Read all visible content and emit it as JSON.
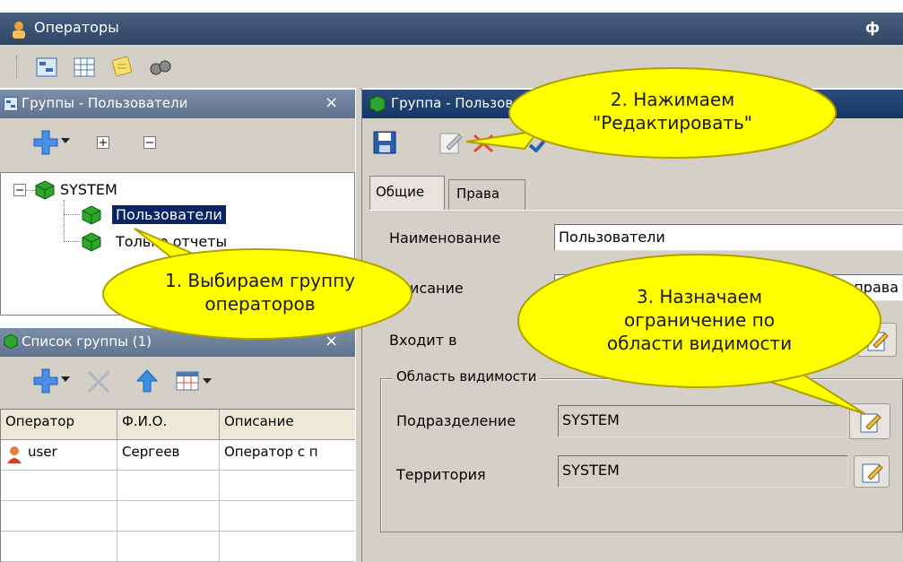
{
  "window": {
    "title": "Операторы",
    "pin_glyph": "ф"
  },
  "groups_panel": {
    "title": "Группы - Пользователи",
    "close_glyph": "×",
    "tree": [
      {
        "label": "SYSTEM",
        "expander": "−"
      },
      {
        "label": "Пользователи",
        "selected": true
      },
      {
        "label": "Только отчеты"
      }
    ]
  },
  "list_panel": {
    "title": "Список группы (1)",
    "close_glyph": "×",
    "columns": [
      "Оператор",
      "Ф.И.О.",
      "Описание"
    ],
    "rows": [
      [
        "user",
        "Сергеев",
        "Оператор с п"
      ]
    ]
  },
  "group_panel": {
    "title": "Группа - Пользователи",
    "tabs": [
      {
        "label": "Общие",
        "active": true
      },
      {
        "label": "Права",
        "active": false
      }
    ],
    "fields": {
      "name_label": "Наименование",
      "name_value": "Пользователи",
      "desc_label": "Описание",
      "desc_value": "Операторы без права",
      "member_of_label": "Входит в",
      "member_of_value": ""
    },
    "visibility": {
      "group_label": "Область видимости",
      "subdivision_label": "Подразделение",
      "subdivision_value": "SYSTEM",
      "territory_label": "Территория",
      "territory_value": "SYSTEM"
    }
  },
  "callouts": {
    "step1": "1. Выбираем группу\nоператоров",
    "step2": "2. Нажимаем\n\"Редактировать\"",
    "step3": "3. Назначаем\nограничение по\nобласти видимости"
  },
  "colors": {
    "title_active": "#143666",
    "title_inactive": "#6f829c",
    "bubble_fill": "#ffff00",
    "selection": "#0a246a"
  }
}
